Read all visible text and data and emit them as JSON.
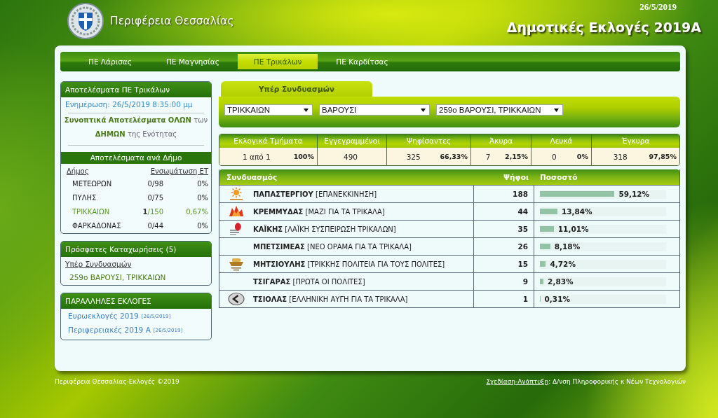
{
  "header": {
    "region": "Περιφέρεια Θεσσαλίας",
    "date": "26/5/2019",
    "title": "Δημοτικές Εκλογές 2019Α"
  },
  "nav_tabs": [
    {
      "label": "ΠΕ Λάρισας",
      "selected": false
    },
    {
      "label": "ΠΕ Μαγνησίας",
      "selected": false
    },
    {
      "label": "ΠΕ Τρικάλων",
      "selected": true
    },
    {
      "label": "ΠΕ Καρδίτσας",
      "selected": false
    }
  ],
  "results_panel": {
    "title": "Αποτελέσματα ΠΕ Τρικάλων",
    "updated": "Ενημέρωση: 26/5/2019 8:35:00 μμ",
    "summary_link": "**Συνοπτικά Αποτελέσματα ΟΛΩΝ** των **ΔΗΜΩΝ** της Ενότητας",
    "subtitle": "Αποτελέσματα ανά Δήμο",
    "columns": [
      "Δήμος",
      "Ενσωμάτωση ΕΤ"
    ],
    "rows": [
      {
        "name": "ΜΕΤΕΩΡΩΝ",
        "counted": "0/98",
        "percent": "0%",
        "selected": false
      },
      {
        "name": "ΠΥΛΗΣ",
        "counted": "0/75",
        "percent": "0%",
        "selected": false
      },
      {
        "name": "ΤΡΙΚΚΑΙΩΝ",
        "counted": "**1**/150",
        "percent": "0,67%",
        "selected": true
      },
      {
        "name": "ΦΑΡΚΑΔΟΝΑΣ",
        "counted": "0/44",
        "percent": "0%",
        "selected": false
      }
    ]
  },
  "recent_panel": {
    "title": "Πρόσφατες Καταχωρήσεις (5)",
    "category": "Υπέρ Συνδυασμών",
    "entries": [
      "259ο ΒΑΡΟΥΣΙ, ΤΡΙΚΚΑΙΩΝ"
    ]
  },
  "parallel_panel": {
    "title": "ΠΑΡΑΛΛΗΛΕΣ ΕΚΛΟΓΕΣ",
    "links": [
      {
        "label": "Ευρωεκλογές 2019",
        "date": "[26/5/2019]"
      },
      {
        "label": "Περιφερειακές 2019 Α",
        "date": "[26/5/2019]"
      }
    ]
  },
  "main_tabs": [
    {
      "label": "Υπέρ Συνδυασμών",
      "selected": true
    }
  ],
  "filters": [
    {
      "value": "ΤΡΙΚΚΑΙΩΝ"
    },
    {
      "value": "ΒΑΡΟΥΣΙ"
    },
    {
      "value": "259ο ΒΑΡΟΥΣΙ, ΤΡΙΚΚΑΙΩΝ"
    }
  ],
  "summary": [
    {
      "label": "Εκλογικά Τμήματα",
      "value": "1 από 1",
      "percent": "100%"
    },
    {
      "label": "Εγγεγραμμένοι",
      "value": "490"
    },
    {
      "label": "Ψηφίσαντες",
      "value": "325",
      "percent": "66,33%"
    },
    {
      "label": "Άκυρα",
      "value": "7",
      "percent": "2,15%"
    },
    {
      "label": "Λευκά",
      "value": "0",
      "percent": "0%"
    },
    {
      "label": "Έγκυρα",
      "value": "318",
      "percent": "97,85%"
    }
  ],
  "results": {
    "columns": [
      "Συνδυασμός",
      "Ψήφοι",
      "Ποσοστό"
    ],
    "rows": [
      {
        "kind": "sun",
        "candidate": "**ΠΑΠΑΣΤΕΡΓΙΟΥ** [ΕΠΑΝΕΚΚΙΝΗΣΗ]",
        "votes": "188",
        "percent": "59,12%",
        "level": 0.5912
      },
      {
        "kind": "flame",
        "candidate": "**ΚΡΕΜΜΥΔΑΣ** [ΜΑΖΙ ΓΙΑ ΤΑ ΤΡΙΚΑΛΑ]",
        "votes": "44",
        "percent": "13,84%",
        "level": 0.1384
      },
      {
        "kind": "drop",
        "candidate": "**ΚΑΪΚΗΣ** [ΛΑΪΚΗ ΣΥΣΠΕΙΡΩΣΗ ΤΡΙΚΑΛΩΝ]",
        "votes": "35",
        "percent": "11,01%",
        "level": 0.1101
      },
      {
        "kind": "plain",
        "candidate": "**ΜΠΕΤΣΙΜΕΑΣ** [ΝΕΟ ΟΡΑΜΑ ΓΙΑ ΤΑ ΤΡΙΚΑΛΑ]",
        "votes": "26",
        "percent": "8,18%",
        "level": 0.0818
      },
      {
        "kind": "boat",
        "candidate": "**ΜΗΤΣΙΟΥΛΗΣ** [ΤΡΙΚΚΗΣ ΠΟΛΙΤΕΙΑ ΓΙΑ ΤΟΥΣ ΠΟΛΙΤΕΣ]",
        "votes": "15",
        "percent": "4,72%",
        "level": 0.0472
      },
      {
        "kind": "plain",
        "candidate": "**ΤΣΙΓΑΡΑΣ** [ΠΡΩΤΑ ΟΙ ΠΟΛΙΤΕΣ]",
        "votes": "9",
        "percent": "2,83%",
        "level": 0.0283
      },
      {
        "kind": "chevron",
        "candidate": "**ΤΣΙΟΛΑΣ** [ΕΛΛΗΝΙΚΗ ΑΥΓΗ ΓΙΑ ΤΑ ΤΡΙΚΑΛΑ]",
        "votes": "1",
        "percent": "0,31%",
        "level": 0.0031
      }
    ]
  },
  "footer": {
    "copyright": "Περιφέρεια Θεσσαλίας-Εκλογές ©2019",
    "credit_link": "Σχεδίαση-Ανάπτυξη",
    "credit": ": Δ/νση Πληροφορικής κ Νέων Τεχνολογιών"
  }
}
